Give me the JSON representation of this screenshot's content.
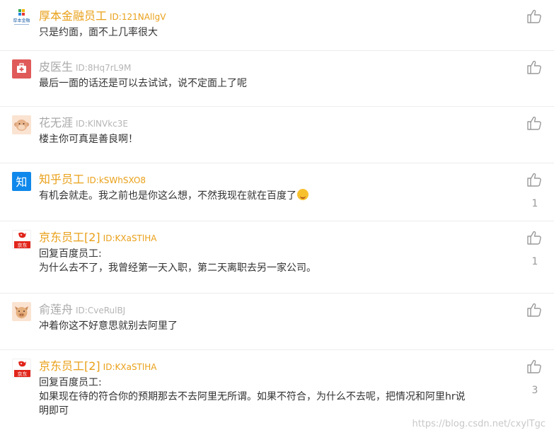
{
  "comments": [
    {
      "name": "厚本金融员工",
      "uid": "ID:121NAllgV",
      "line1": "只是约面，面不上几率很大",
      "line2": "",
      "line3": "",
      "like_count": "",
      "avatar": "houben-logo-icon",
      "avatar_text": "厚本金融"
    },
    {
      "name": "皮医生",
      "uid": "ID:8Hq7rL9M",
      "line1": "最后一面的话还是可以去试试，说不定面上了呢",
      "line2": "",
      "line3": "",
      "like_count": "",
      "avatar": "medical-kit-icon"
    },
    {
      "name": "花无涯",
      "uid": "ID:KlNVkc3E",
      "line1": "楼主你可真是善良啊！",
      "line2": "",
      "line3": "",
      "like_count": "",
      "avatar": "monkey-face-icon"
    },
    {
      "name": "知乎员工",
      "uid": "ID:kSWhSXO8",
      "line1": "有机会就走。我之前也是你这么想，不然我现在就在百度了",
      "line2": "",
      "line3": "",
      "like_count": "1",
      "avatar": "zhihu-logo-icon",
      "avatar_text": "知"
    },
    {
      "name": "京东员工[2]",
      "uid": "ID:KXaSTlHA",
      "line1": "回复百度员工:",
      "line2": "为什么去不了，我曾经第一天入职，第二天离职去另一家公司。",
      "line3": "",
      "like_count": "1",
      "avatar": "jd-logo-icon",
      "avatar_text": "京东"
    },
    {
      "name": "俞莲舟",
      "uid": "ID:CveRulBJ",
      "line1": "冲着你这不好意思就别去阿里了",
      "line2": "",
      "line3": "",
      "like_count": "",
      "avatar": "pig-face-icon"
    },
    {
      "name": "京东员工[2]",
      "uid": "ID:KXaSTlHA",
      "line1": "回复百度员工:",
      "line2": "如果现在待的符合你的预期那去不去阿里无所谓。如果不符合，为什么不去呢，把情况和阿里hr说",
      "line3": "明即可",
      "like_count": "3",
      "avatar": "jd-logo-icon",
      "avatar_text": "京东"
    }
  ],
  "watermark": "https://blog.csdn.net/cxylTgc",
  "colors": {
    "staff_name": "#e9a019",
    "user_name": "#a8a8a8",
    "divider": "#ececec"
  }
}
